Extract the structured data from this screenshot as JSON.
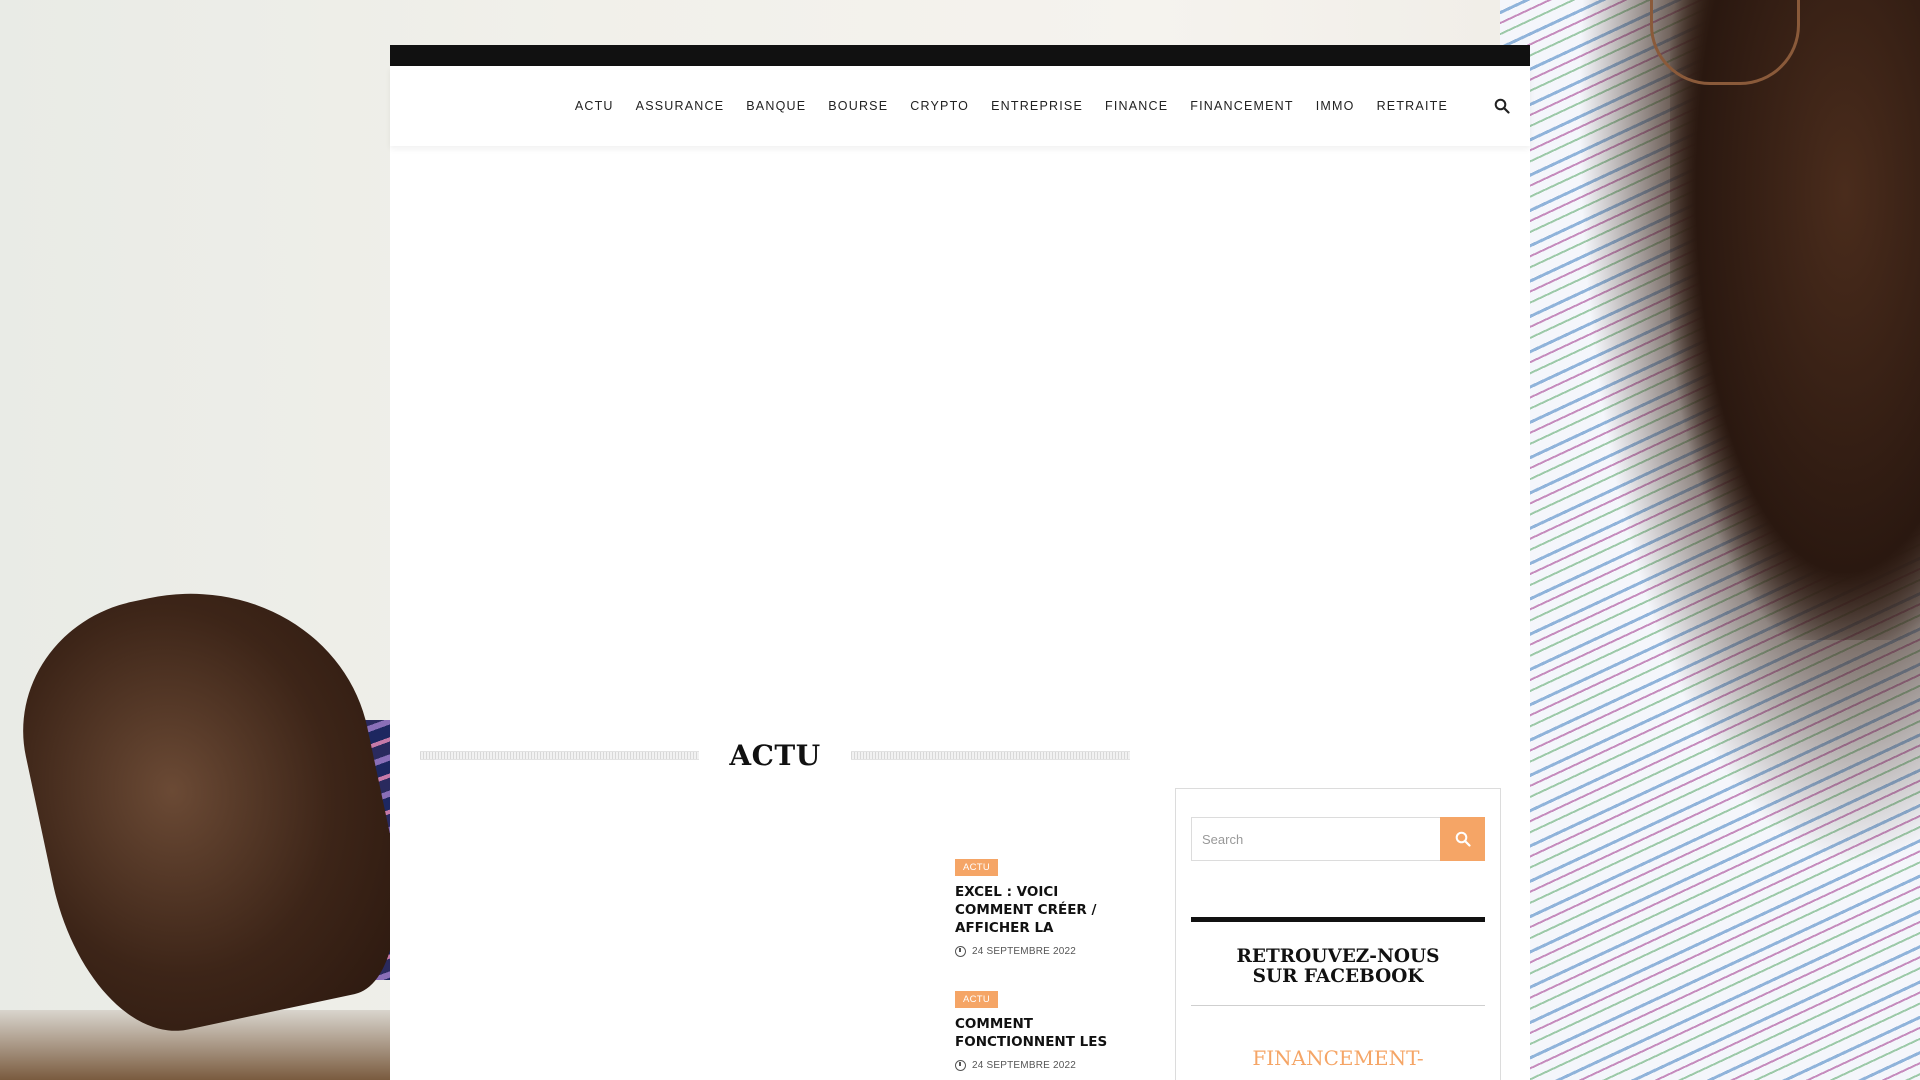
{
  "nav": {
    "items": [
      "ACTU",
      "ASSURANCE",
      "BANQUE",
      "BOURSE",
      "CRYPTO",
      "ENTREPRISE",
      "FINANCE",
      "FINANCEMENT",
      "IMMO",
      "RETRAITE"
    ]
  },
  "section": {
    "title": "ACTU"
  },
  "articles": [
    {
      "category": "ACTU",
      "title": "EXCEL : VOICI COMMENT CRÉER / AFFICHER LA",
      "date": "24 SEPTEMBRE 2022"
    },
    {
      "category": "ACTU",
      "title": "COMMENT FONCTIONNENT LES",
      "date": "24 SEPTEMBRE 2022"
    }
  ],
  "sidebar": {
    "search_placeholder": "Search",
    "widget_title": "RETROUVEZ-NOUS SUR FACEBOOK",
    "facebook_name": "FINANCEMENT-"
  },
  "colors": {
    "accent": "#f5a566",
    "topbar": "#111111"
  }
}
